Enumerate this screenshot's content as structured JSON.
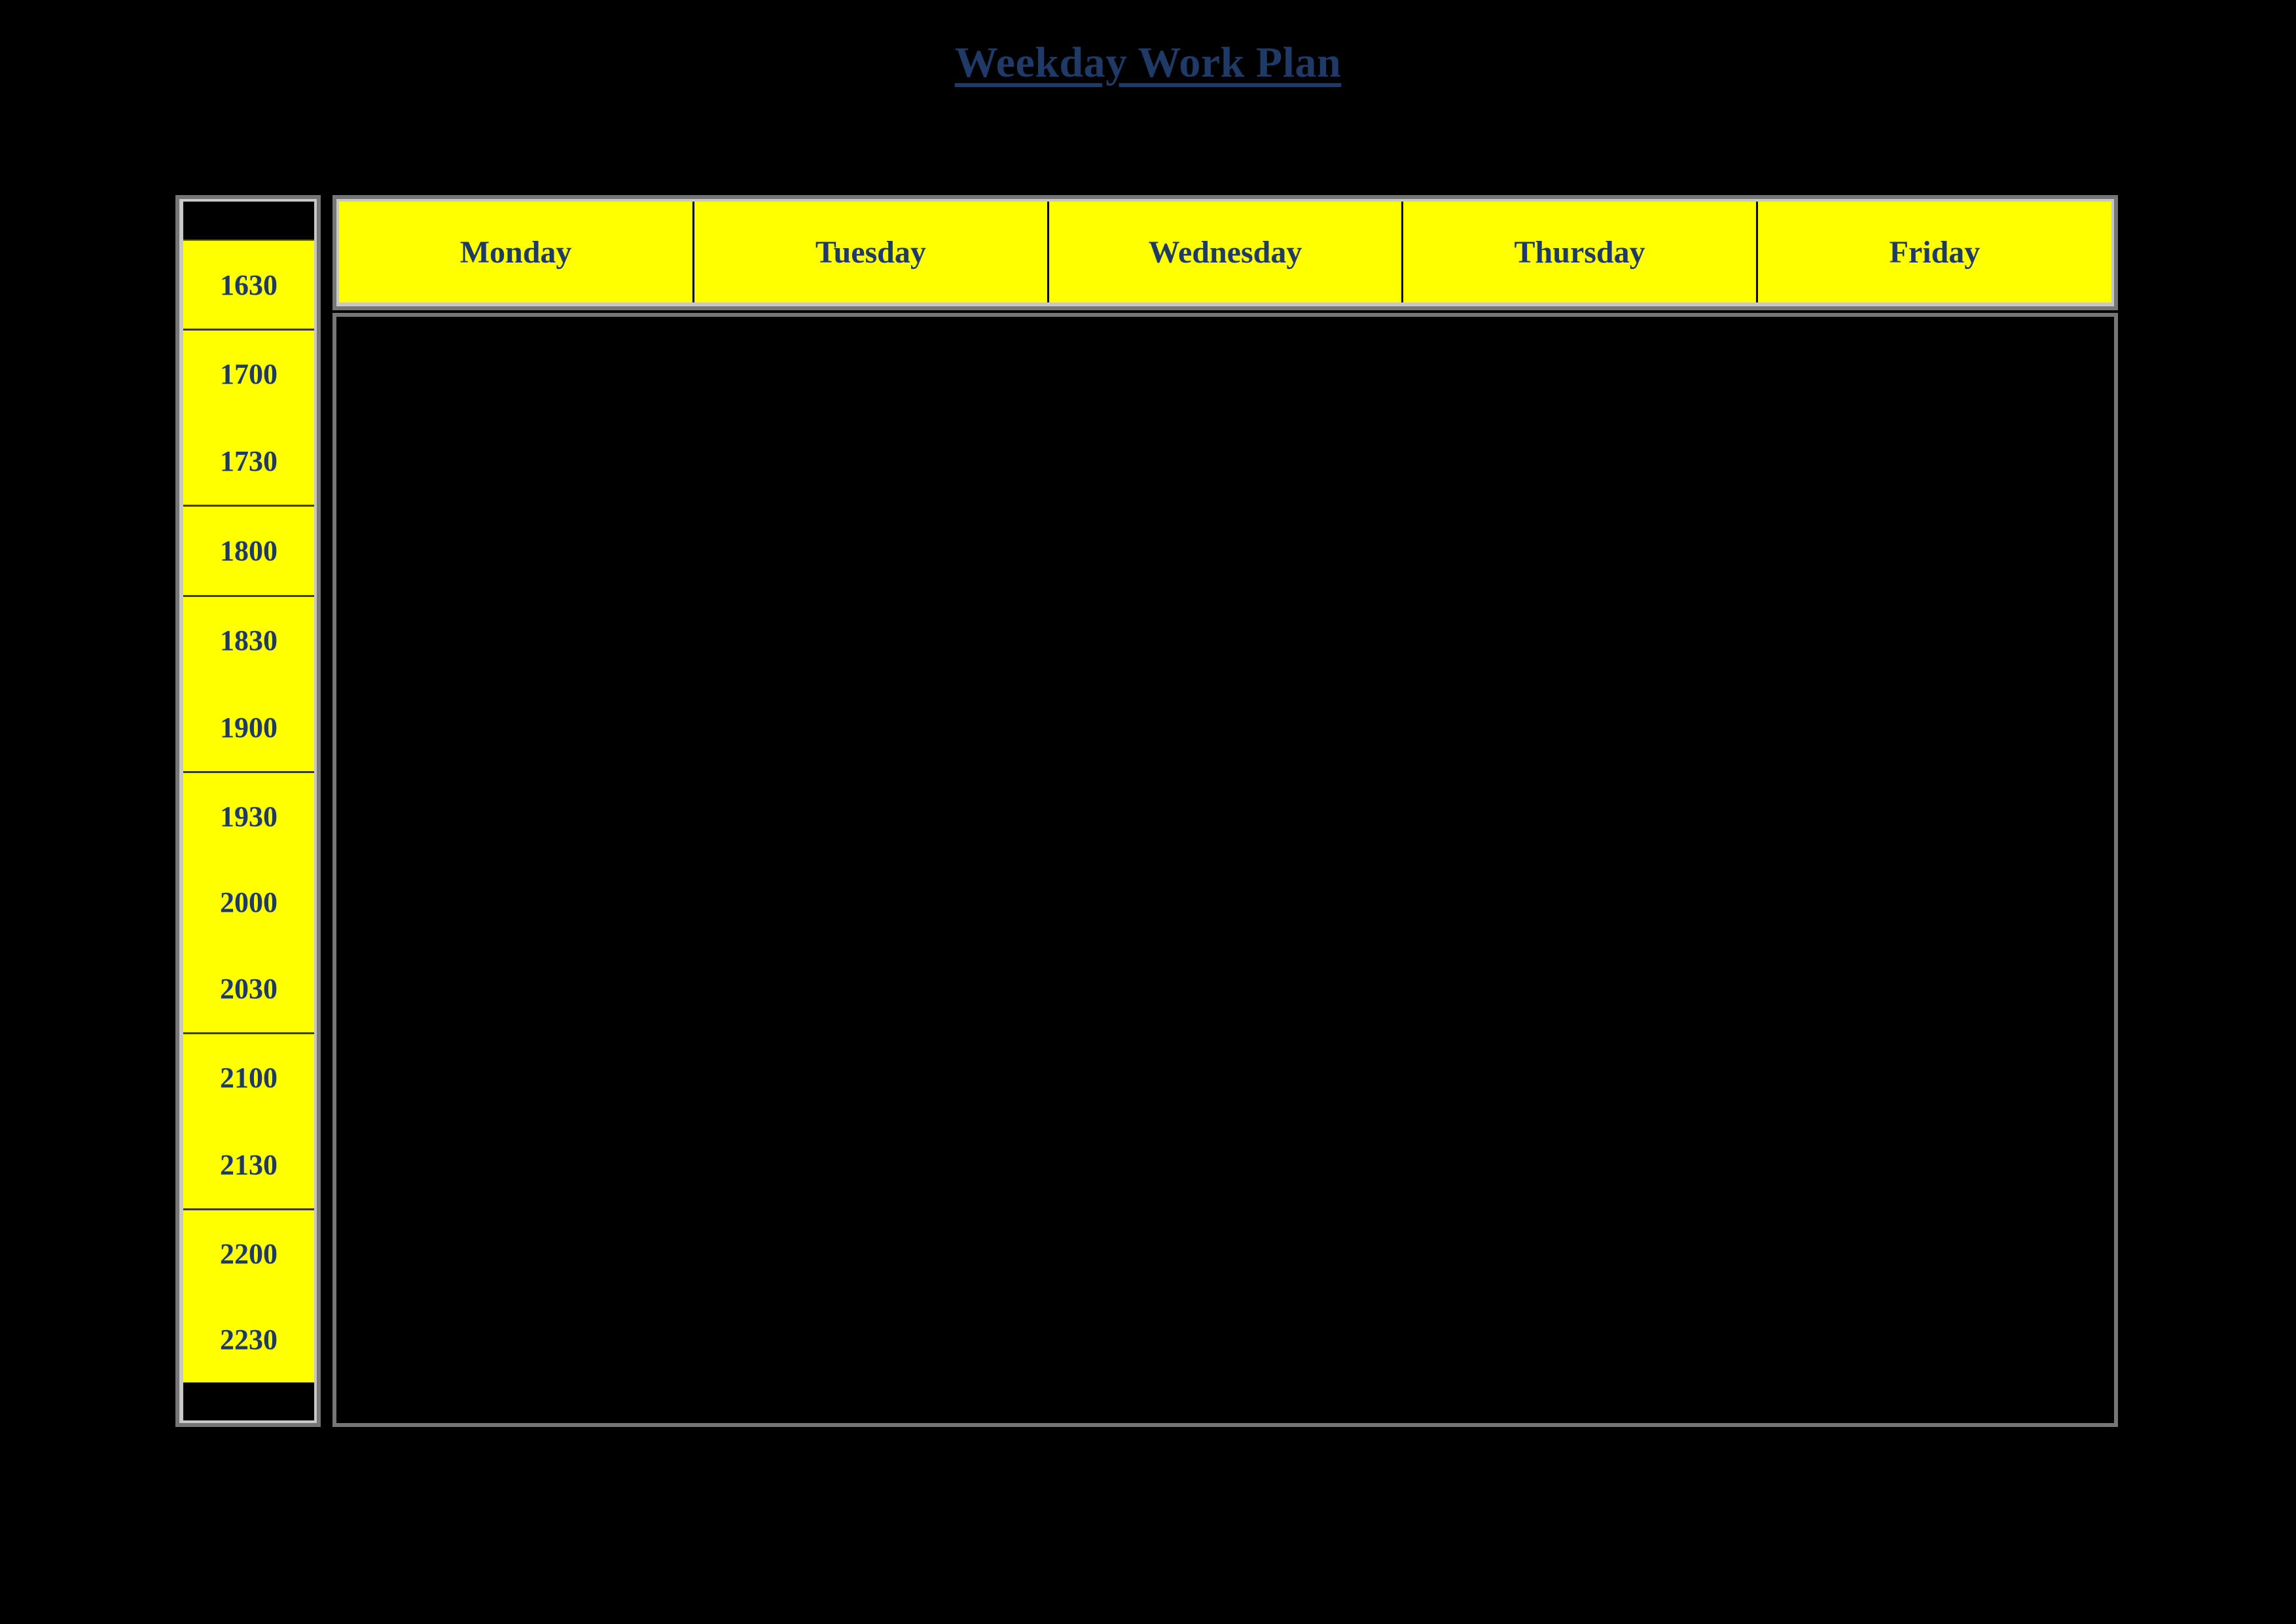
{
  "page": {
    "title": "Weekday Work Plan",
    "background_color": "#000000"
  },
  "colors": {
    "cell_background": "#ffff00",
    "text": "#1f3a66",
    "title": "#1f3a66",
    "frame_outer": "#767676",
    "frame_inner": "#c8c8c8",
    "grid_line": "#000000",
    "empty_area": "#000000"
  },
  "planner": {
    "time_column": {
      "header_label": "",
      "footer_label": "",
      "slots": [
        {
          "label": "1630"
        },
        {
          "label": "1700"
        },
        {
          "label": "1730"
        },
        {
          "label": "1800"
        },
        {
          "label": "1830"
        },
        {
          "label": "1900"
        },
        {
          "label": "1930"
        },
        {
          "label": "2000"
        },
        {
          "label": "2030"
        },
        {
          "label": "2100"
        },
        {
          "label": "2130"
        },
        {
          "label": "2200"
        },
        {
          "label": "2230"
        }
      ],
      "group_starts": [
        0,
        1,
        3,
        4,
        6,
        9,
        11
      ]
    },
    "days": [
      {
        "label": "Monday"
      },
      {
        "label": "Tuesday"
      },
      {
        "label": "Wednesday"
      },
      {
        "label": "Thursday"
      },
      {
        "label": "Friday"
      }
    ],
    "entries": []
  }
}
